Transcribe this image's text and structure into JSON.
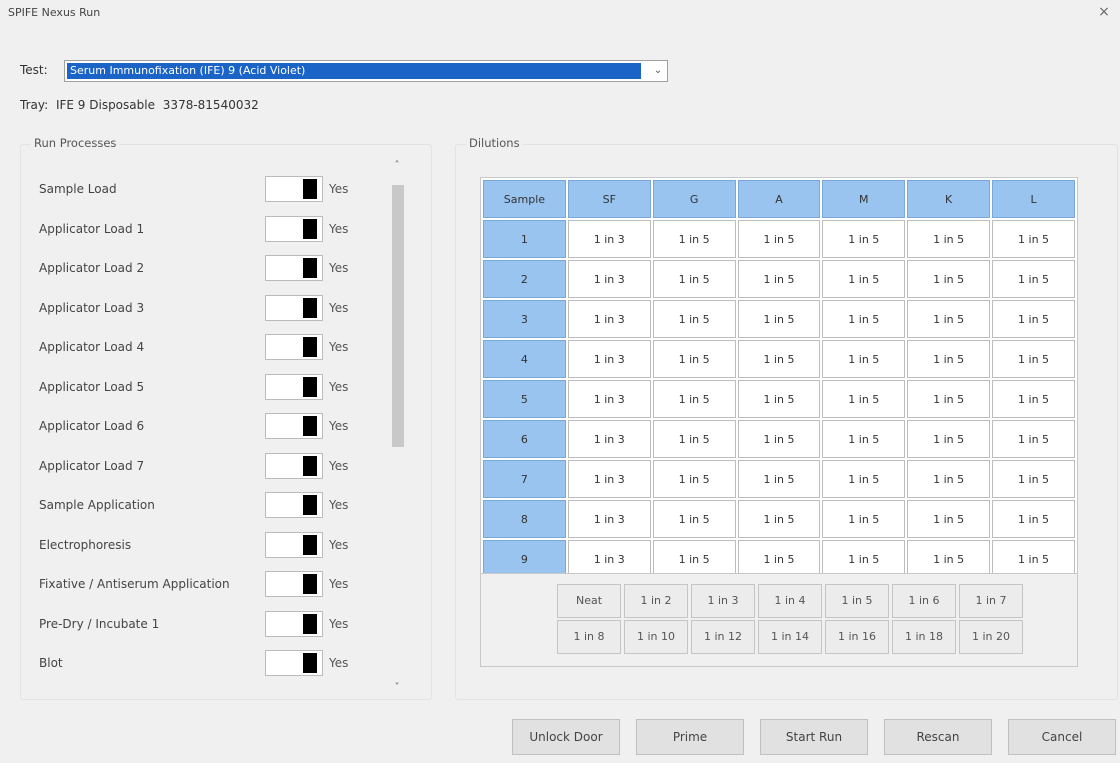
{
  "window": {
    "title": "SPIFE Nexus Run",
    "close": "×"
  },
  "test": {
    "label": "Test:",
    "selected": "Serum Immunofixation (IFE) 9 (Acid Violet)",
    "chevron": "⌄"
  },
  "tray": {
    "label": "Tray:",
    "name": "IFE 9 Disposable",
    "code": "3378-81540032"
  },
  "run_processes": {
    "title": "Run Processes",
    "items": [
      {
        "label": "Sample Load",
        "state": "Yes"
      },
      {
        "label": "Applicator Load 1",
        "state": "Yes"
      },
      {
        "label": "Applicator Load 2",
        "state": "Yes"
      },
      {
        "label": "Applicator Load 3",
        "state": "Yes"
      },
      {
        "label": "Applicator Load 4",
        "state": "Yes"
      },
      {
        "label": "Applicator Load 5",
        "state": "Yes"
      },
      {
        "label": "Applicator Load 6",
        "state": "Yes"
      },
      {
        "label": "Applicator Load 7",
        "state": "Yes"
      },
      {
        "label": "Sample Application",
        "state": "Yes"
      },
      {
        "label": "Electrophoresis",
        "state": "Yes"
      },
      {
        "label": "Fixative / Antiserum Application",
        "state": "Yes"
      },
      {
        "label": "Pre-Dry / Incubate 1",
        "state": "Yes"
      },
      {
        "label": "Blot",
        "state": "Yes"
      }
    ],
    "scroll_up": "˄",
    "scroll_down": "˅"
  },
  "dilutions": {
    "title": "Dilutions",
    "columns": [
      "Sample",
      "SF",
      "G",
      "A",
      "M",
      "K",
      "L"
    ],
    "rows": [
      {
        "sample": "1",
        "values": [
          "1 in 3",
          "1 in 5",
          "1 in 5",
          "1 in 5",
          "1 in 5",
          "1 in 5"
        ]
      },
      {
        "sample": "2",
        "values": [
          "1 in 3",
          "1 in 5",
          "1 in 5",
          "1 in 5",
          "1 in 5",
          "1 in 5"
        ]
      },
      {
        "sample": "3",
        "values": [
          "1 in 3",
          "1 in 5",
          "1 in 5",
          "1 in 5",
          "1 in 5",
          "1 in 5"
        ]
      },
      {
        "sample": "4",
        "values": [
          "1 in 3",
          "1 in 5",
          "1 in 5",
          "1 in 5",
          "1 in 5",
          "1 in 5"
        ]
      },
      {
        "sample": "5",
        "values": [
          "1 in 3",
          "1 in 5",
          "1 in 5",
          "1 in 5",
          "1 in 5",
          "1 in 5"
        ]
      },
      {
        "sample": "6",
        "values": [
          "1 in 3",
          "1 in 5",
          "1 in 5",
          "1 in 5",
          "1 in 5",
          "1 in 5"
        ]
      },
      {
        "sample": "7",
        "values": [
          "1 in 3",
          "1 in 5",
          "1 in 5",
          "1 in 5",
          "1 in 5",
          "1 in 5"
        ]
      },
      {
        "sample": "8",
        "values": [
          "1 in 3",
          "1 in 5",
          "1 in 5",
          "1 in 5",
          "1 in 5",
          "1 in 5"
        ]
      },
      {
        "sample": "9",
        "values": [
          "1 in 3",
          "1 in 5",
          "1 in 5",
          "1 in 5",
          "1 in 5",
          "1 in 5"
        ]
      }
    ],
    "palette": [
      [
        "Neat",
        "1 in 2",
        "1 in 3",
        "1 in 4",
        "1 in 5",
        "1 in 6",
        "1 in 7"
      ],
      [
        "1 in 8",
        "1 in 10",
        "1 in 12",
        "1 in 14",
        "1 in 16",
        "1 in 18",
        "1 in 20"
      ]
    ]
  },
  "buttons": {
    "unlock_door": "Unlock Door",
    "prime": "Prime",
    "start_run": "Start Run",
    "rescan": "Rescan",
    "cancel": "Cancel"
  },
  "colors": {
    "selection_blue": "#1a64c8",
    "header_blue": "#99c4ef",
    "window_bg": "#f0f0f0"
  }
}
